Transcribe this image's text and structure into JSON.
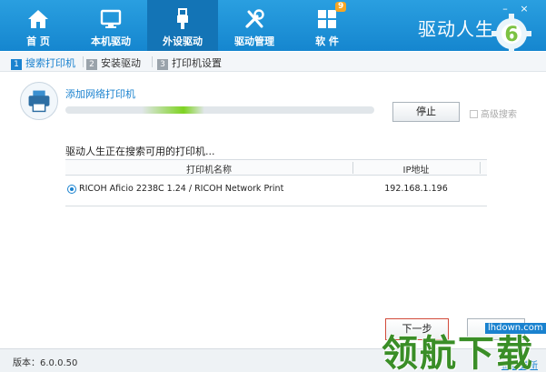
{
  "nav": {
    "items": [
      {
        "label": "首 页",
        "icon": "home-icon"
      },
      {
        "label": "本机驱动",
        "icon": "monitor-icon"
      },
      {
        "label": "外设驱动",
        "icon": "usb-icon"
      },
      {
        "label": "驱动管理",
        "icon": "tools-icon"
      },
      {
        "label": "软 件",
        "icon": "apps-grid-icon",
        "badge": "9"
      }
    ],
    "active": "外设驱动",
    "brand": "驱动人生",
    "logo_text": "6",
    "window_controls": [
      "–",
      "×"
    ]
  },
  "steps": [
    {
      "num": "1",
      "label": "搜索打印机"
    },
    {
      "num": "2",
      "label": "安装驱动"
    },
    {
      "num": "3",
      "label": "打印机设置"
    }
  ],
  "search": {
    "add_network_printer": "添加网络打印机",
    "progress": 0.45,
    "stop_label": "停止",
    "advanced_search_label": "高级搜索",
    "status_text": "驱动人生正在搜索可用的打印机..."
  },
  "table": {
    "columns": [
      "打印机名称",
      "IP地址"
    ],
    "rows": [
      {
        "name": "RICOH Aficio 2238C 1.24 / RICOH Network Print",
        "ip": "192.168.1.196",
        "selected": true
      }
    ]
  },
  "buttons": {
    "next_label": "下一步",
    "cancel_label": ""
  },
  "footer": {
    "version": "版本：6.0.0.50",
    "check_update": "检查更新"
  },
  "watermark": {
    "site": "lhdown.com",
    "text": "领航下载"
  },
  "colors": {
    "header_blue": "#1a8ad4",
    "accent": "#1a82cf",
    "progress_green": "#7ed321"
  }
}
